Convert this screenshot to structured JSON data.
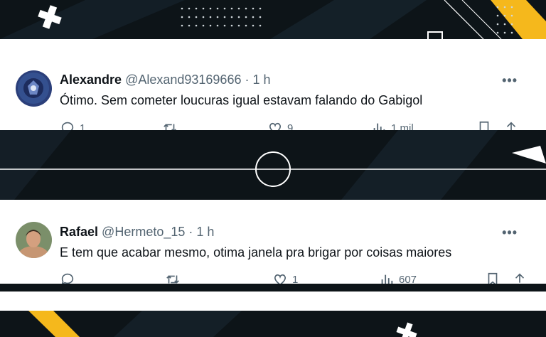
{
  "tweets": [
    {
      "name": "Alexandre",
      "handle": "@Alexand93169666",
      "dot": "·",
      "time": "1 h",
      "text": "Ótimo. Sem cometer loucuras igual estavam falando do Gabigol",
      "more": "•••",
      "replies": "1",
      "retweets": "",
      "likes": "9",
      "views": "1 mil"
    },
    {
      "name": "Rafael",
      "handle": "@Hermeto_15",
      "dot": "·",
      "time": "1 h",
      "text": "E tem que acabar mesmo, otima janela pra brigar por coisas maiores",
      "more": "•••",
      "replies": "",
      "retweets": "",
      "likes": "1",
      "views": "607"
    }
  ],
  "icons": {
    "reply": "reply-icon",
    "retweet": "retweet-icon",
    "like": "heart-icon",
    "views": "views-icon",
    "bookmark": "bookmark-icon",
    "share": "share-icon"
  },
  "colors": {
    "background": "#0d1418",
    "accent_yellow": "#f5b81c",
    "card": "#ffffff",
    "text_primary": "#0f1419",
    "text_secondary": "#536471"
  }
}
